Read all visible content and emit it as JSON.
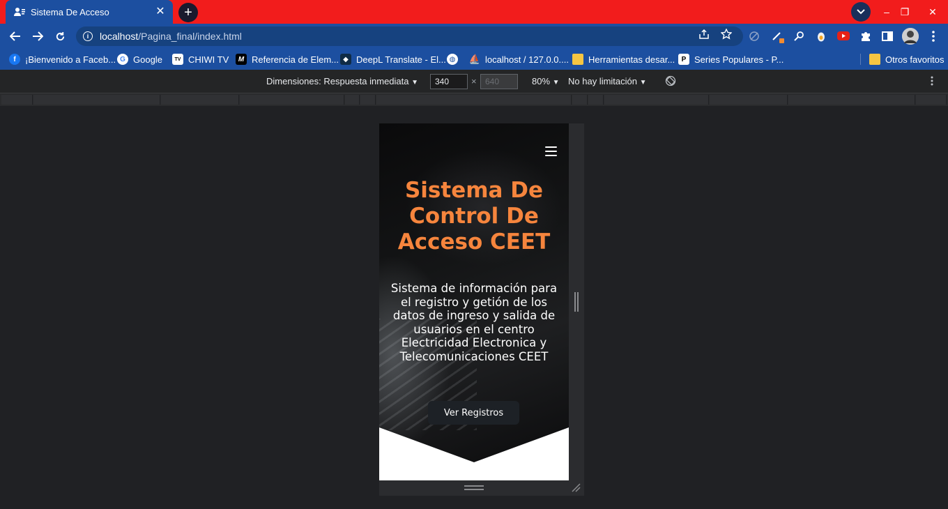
{
  "tab": {
    "title": "Sistema De Acceso",
    "close": "✕",
    "new_tab": "+"
  },
  "window": {
    "minimize": "–",
    "restore": "❐",
    "close": "✕"
  },
  "address": {
    "host": "localhost",
    "path": "/Pagina_final/index.html"
  },
  "bookmarks": [
    {
      "label": "¡Bienvenido a Faceb...",
      "icon": "facebook-icon",
      "color": "#1877f2"
    },
    {
      "label": "Google",
      "icon": "google-icon",
      "color": "#ffffff"
    },
    {
      "label": "CHIWI TV",
      "icon": "tv-icon",
      "color": "#ffffff"
    },
    {
      "label": "Referencia de Elem...",
      "icon": "mdn-icon",
      "color": "#000000"
    },
    {
      "label": "DeepL Translate - El...",
      "icon": "deepl-icon",
      "color": "#0f2b46"
    },
    {
      "label": "",
      "icon": "globe-icon",
      "color": "#ffffff"
    },
    {
      "label": "localhost / 127.0.0....",
      "icon": "phpmyadmin-icon",
      "color": "#f29111"
    },
    {
      "label": "Herramientas desar...",
      "icon": "folder-icon",
      "color": "#f5c542"
    },
    {
      "label": "Series Populares - P...",
      "icon": "p-icon",
      "color": "#ffffff"
    }
  ],
  "other_bookmarks": "Otros favoritos",
  "devtools": {
    "dimensions_label": "Dimensiones: Respuesta inmediata",
    "width_value": "340",
    "height_value": "640",
    "times": "×",
    "zoom": "80%",
    "throttle": "No hay limitación"
  },
  "page": {
    "title": "Sistema De Control De Acceso CEET",
    "subtitle": "Sistema de información para el registro y getión de los datos de ingreso y salida de usuarios en el centro Electricidad Electronica y Telecomunicaciones CEET",
    "button": "Ver Registros",
    "title_color": "#f6853d"
  }
}
